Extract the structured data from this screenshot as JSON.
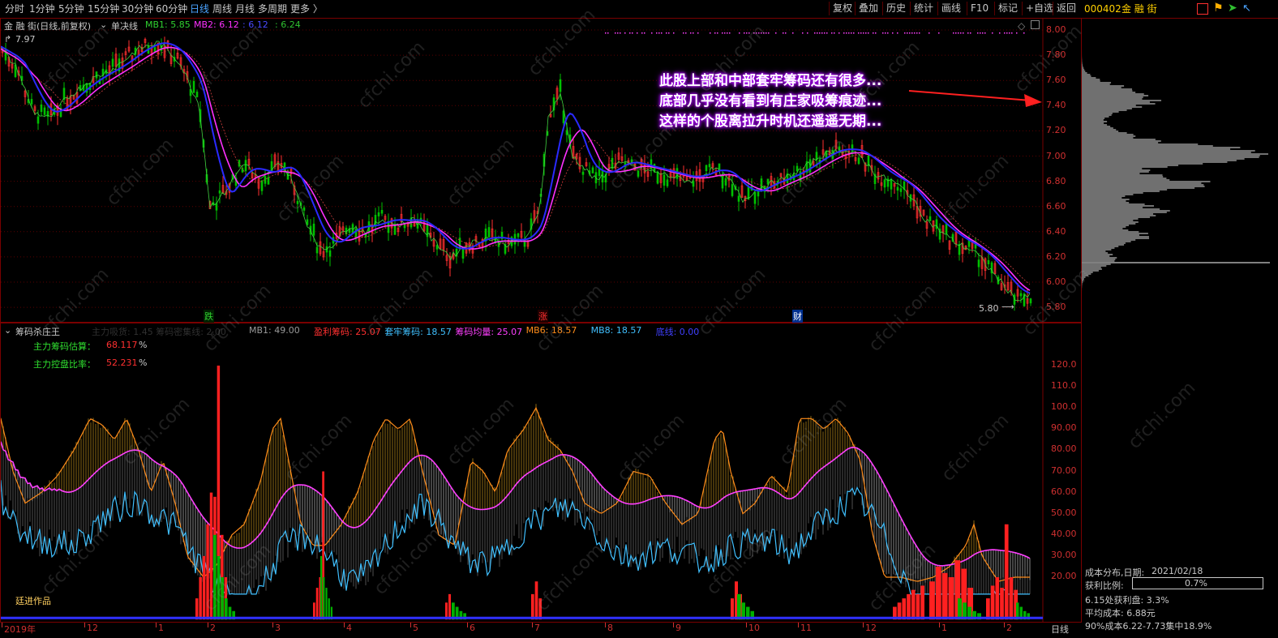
{
  "toolbar": {
    "left_items": [
      "分时",
      "1分钟",
      "5分钟",
      "15分钟",
      "30分钟",
      "60分钟",
      "日线",
      "周线",
      "月线",
      "多周期",
      "更多 〉"
    ],
    "active": "日线",
    "right_items": [
      "复权",
      "叠加",
      "历史",
      "统计",
      "画线",
      "F10",
      "标记",
      "+自选",
      "返回"
    ]
  },
  "stock": {
    "code": "000402",
    "name": "金 融 街"
  },
  "main_header": {
    "title": "金 融 街(日线,前复权)",
    "indicator": "单决线",
    "mb1": "MB1: 5.85",
    "mb2": "MB2: 6.12",
    "v3": ": 6.12",
    "v4": ": 6.24",
    "high_label": "7.97",
    "low_label": "5.80"
  },
  "annotation": [
    "此股上部和中部套牢筹码还有很多...",
    "底部几乎没有看到有庄家吸筹痕迹...",
    "这样的个股离拉升时机还遥遥无期..."
  ],
  "event_markers": [
    "跌",
    "涨",
    "财"
  ],
  "price_axis": [
    "8.00",
    "7.80",
    "7.60",
    "7.40",
    "7.20",
    "7.00",
    "6.80",
    "6.60",
    "6.40",
    "6.20",
    "6.00",
    "5.80"
  ],
  "indicator": {
    "name": "筹码杀庄王",
    "faded": "主力吸货: 1.45  筹码密集线: 2.00",
    "items": [
      {
        "label": "MB1: 49.00",
        "color": "#9a9a9a"
      },
      {
        "label": "盈利筹码: 25.07",
        "color": "#ff3030"
      },
      {
        "label": "套牢筹码: 18.57",
        "color": "#40c0ff"
      },
      {
        "label": "筹码均量: 25.07",
        "color": "#ff40ff"
      },
      {
        "label": "MB6: 18.57",
        "color": "#ff8c1a"
      },
      {
        "label": "MB8: 18.57",
        "color": "#40c0ff"
      },
      {
        "label": "底线: 0.00",
        "color": "#4040ff"
      }
    ],
    "main_est_label": "主力筹码估算：",
    "main_est_value": "68.117",
    "main_ctrl_label": "主力控盘比率：",
    "main_ctrl_value": "52.231",
    "pct": "%",
    "author": "廷进作品"
  },
  "ind_axis": [
    "120.0",
    "110.0",
    "100.0",
    "90.00",
    "80.00",
    "70.00",
    "60.00",
    "50.00",
    "40.00",
    "30.00",
    "20.00"
  ],
  "x_axis": [
    "2019年",
    "12",
    "1",
    "2",
    "3",
    "4",
    "5",
    "6",
    "7",
    "8",
    "9",
    "10",
    "11",
    "12",
    "1",
    "2"
  ],
  "period_label": "日线",
  "chip": {
    "title": "成本分布,日期:",
    "date": "2021/02/18",
    "profit_label": "获利比例:",
    "profit_value": "0.7%",
    "line1": "6.15处获利盘: 3.3%",
    "line2": "平均成本: 6.88元",
    "line3": "90%成本6.22-7.73集中18.9%"
  },
  "watermark": "cfchi.com",
  "colors": {
    "up": "#ff3030",
    "down": "#00c000",
    "mb_blue": "#2a2aff",
    "mb_magenta": "#ff30ff",
    "axis_red": "#d03030"
  }
}
